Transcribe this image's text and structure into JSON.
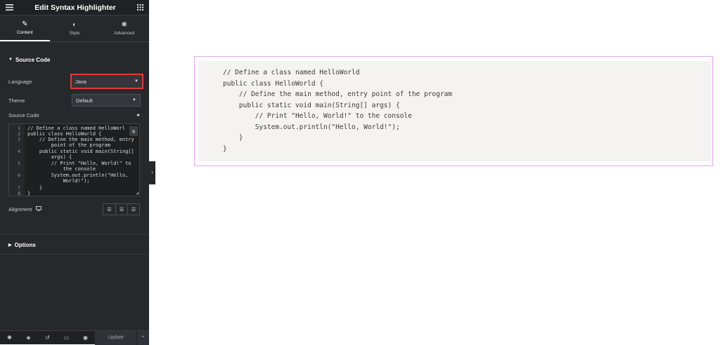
{
  "panel": {
    "title": "Edit Syntax Highlighter",
    "tabs": [
      {
        "label": "Content",
        "icon": "pencil-icon"
      },
      {
        "label": "Style",
        "icon": "contrast-icon"
      },
      {
        "label": "Advanced",
        "icon": "gear-icon"
      }
    ],
    "source_section": "Source Code",
    "language_label": "Language",
    "language_value": "Java",
    "theme_label": "Theme",
    "theme_value": "Default",
    "source_label": "Source Code",
    "editor_lines": [
      {
        "n": "1",
        "text": "// Define a class named HelloWorl"
      },
      {
        "n": "2",
        "text": "public class HelloWorld {"
      },
      {
        "n": "3",
        "text": "    // Define the main method, entry"
      },
      {
        "n": "",
        "text": "        point of the program"
      },
      {
        "n": "4",
        "text": "    public static void main(String[]"
      },
      {
        "n": "",
        "text": "        args) {"
      },
      {
        "n": "5",
        "text": "        // Print \"Hello, World!\" to"
      },
      {
        "n": "",
        "text": "            the console"
      },
      {
        "n": "6",
        "text": "        System.out.println(\"Hello,"
      },
      {
        "n": "",
        "text": "            World!\");"
      },
      {
        "n": "7",
        "text": "    }"
      },
      {
        "n": "8",
        "text": "}"
      }
    ],
    "alignment_label": "Alignment",
    "options_section": "Options",
    "update_label": "Update"
  },
  "preview": {
    "code_lines": [
      "// Define a class named HelloWorld",
      "public class HelloWorld {",
      "    // Define the main method, entry point of the program",
      "    public static void main(String[] args) {",
      "        // Print \"Hello, World!\" to the console",
      "        System.out.println(\"Hello, World!\");",
      "    }",
      "}"
    ]
  },
  "colors": {
    "panel_bg": "#26292c",
    "highlight_border": "#e53935",
    "frame_border": "#e7a6f0",
    "code_bg": "#f4f3f1"
  }
}
